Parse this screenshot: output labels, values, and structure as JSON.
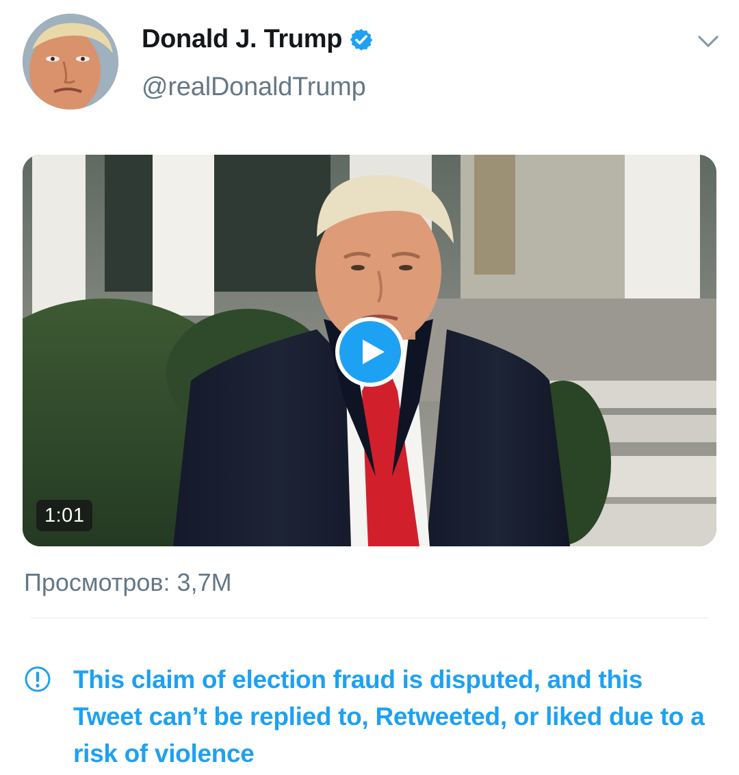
{
  "author": {
    "display_name": "Donald J. Trump",
    "handle": "@realDonaldTrump",
    "verified": true
  },
  "menu": {
    "icon": "chevron-down-icon"
  },
  "media": {
    "duration": "1:01",
    "play_icon": "play-icon"
  },
  "views_text": "Просмотров: 3,7M",
  "notice": {
    "icon": "exclamation-circle-icon",
    "text": "This claim of election fraud is disputed, and this Tweet can’t be replied to, Retweeted, or liked due to a risk of violence"
  },
  "colors": {
    "accent": "#1da1f2",
    "primary_text": "#14171a",
    "secondary_text": "#657786",
    "divider": "#e1e8ed"
  }
}
